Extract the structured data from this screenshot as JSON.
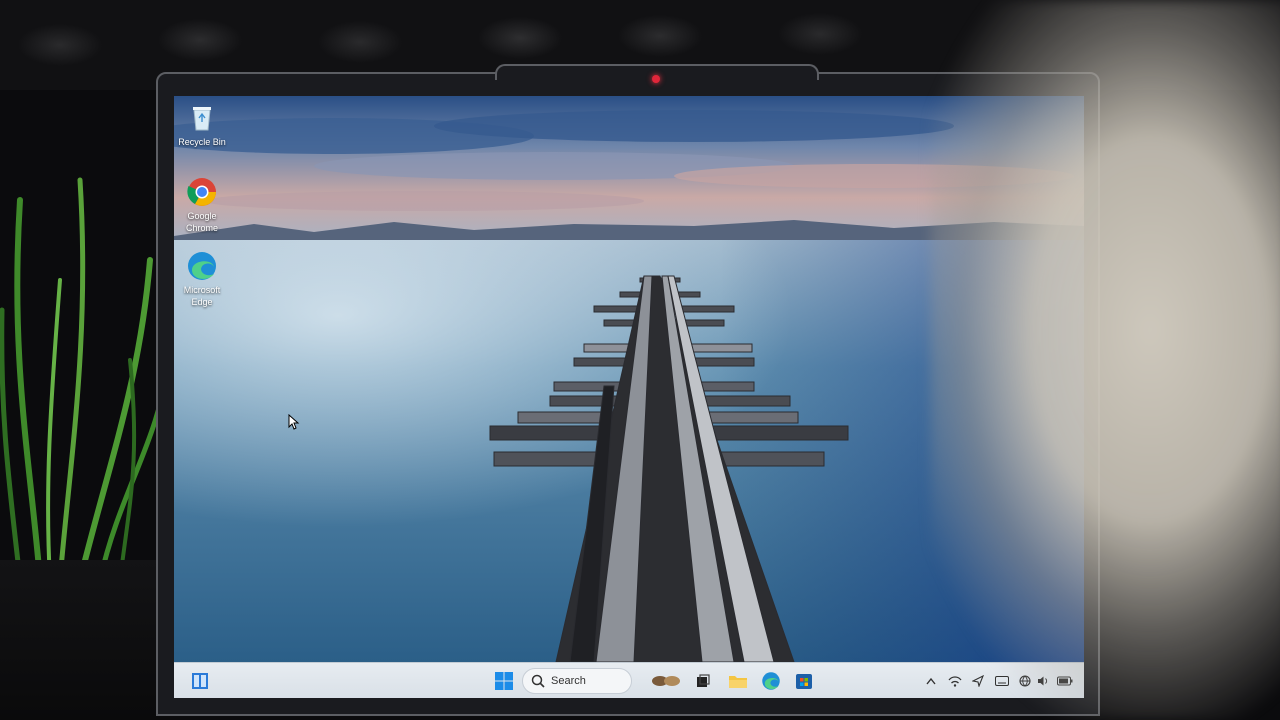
{
  "desktop": {
    "icons": [
      {
        "name": "recycle-bin",
        "label": "Recycle Bin"
      },
      {
        "name": "google-chrome",
        "label": "Google Chrome"
      },
      {
        "name": "microsoft-edge",
        "label": "Microsoft Edge"
      }
    ]
  },
  "taskbar": {
    "search_placeholder": "Search",
    "pinned": [
      "widgets-icon",
      "start-icon",
      "search",
      "copilot-icon",
      "task-view-icon",
      "file-explorer-icon",
      "edge-icon",
      "store-icon"
    ],
    "tray": [
      "chevron-up-icon",
      "network-icon",
      "send-icon",
      "keyboard-icon",
      "wifi-icon",
      "volume-icon",
      "battery-icon"
    ]
  },
  "colors": {
    "taskbar_bg": "#e3e8ee",
    "windows_blue": "#1c8ce8",
    "camera_led": "#e0263a"
  }
}
